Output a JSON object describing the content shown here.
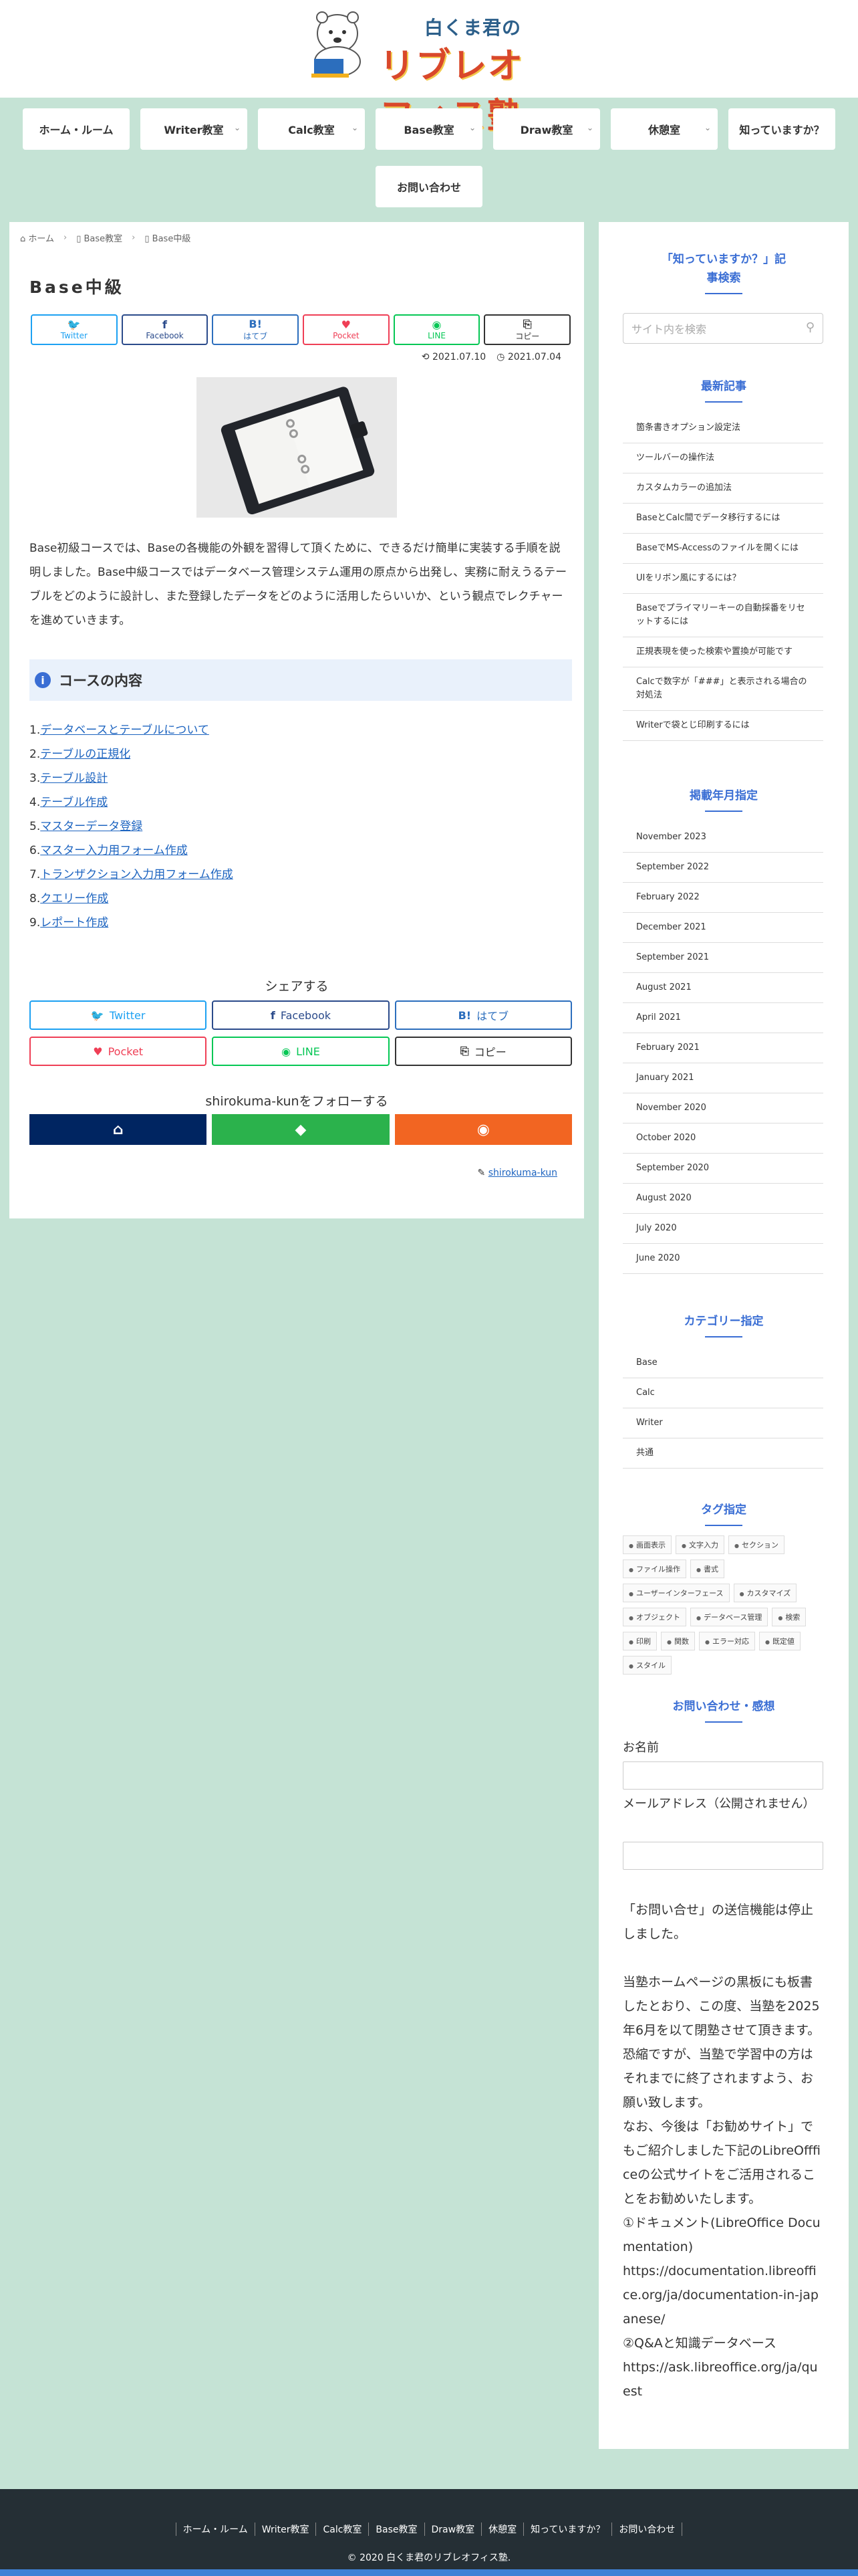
{
  "colors": {
    "background": "#c5e3d5",
    "accent": "#3a6ed4",
    "link": "#1d64c0",
    "footer": "#252f35",
    "twitter": "#1da1f2",
    "facebook": "#2b4b8b",
    "hatebu": "#2c6ebd",
    "pocket": "#ef3f56",
    "line": "#06c755",
    "copy": "#333333",
    "follow_home": "#002561",
    "follow_feedly": "#2bb24c",
    "follow_rss": "#f26522"
  },
  "header": {
    "logo_line1": "白くま君の",
    "logo_line2": "リブレオフィス塾",
    "logo_icon": "polar-bear-laptop-logo"
  },
  "nav": [
    {
      "label": "ホーム・ルーム",
      "dropdown": false
    },
    {
      "label": "Writer教室",
      "dropdown": true
    },
    {
      "label": "Calc教室",
      "dropdown": true
    },
    {
      "label": "Base教室",
      "dropdown": true
    },
    {
      "label": "Draw教室",
      "dropdown": true
    },
    {
      "label": "休憩室",
      "dropdown": true
    },
    {
      "label": "知っていますか？",
      "dropdown": false
    },
    {
      "label": "お問い合わせ",
      "dropdown": false
    }
  ],
  "breadcrumb": [
    "ホーム",
    "Base教室",
    "Base中級"
  ],
  "article": {
    "title": "Base中級",
    "updated": "2021.07.10",
    "published": "2021.07.04",
    "body": "Base初級コースでは、Baseの各機能の外観を習得して頂くために、できるだけ簡単に実装する手順を説明しました。Base中級コースではデータベース管理システム運用の原点から出発し、実務に耐えうるテーブルをどのように設計し、また登録したデータをどのように活用したらいいか、という観点でレクチャーを進めていきます。",
    "toc_title": "コースの内容",
    "toc": [
      {
        "num": "1.",
        "label": "データベースとテーブルについて"
      },
      {
        "num": "2.",
        "label": "テーブルの正規化"
      },
      {
        "num": "3.",
        "label": "テーブル設計"
      },
      {
        "num": "4.",
        "label": "テーブル作成"
      },
      {
        "num": "5.",
        "label": "マスターデータ登録"
      },
      {
        "num": "6.",
        "label": "マスター入力用フォーム作成"
      },
      {
        "num": "7.",
        "label": "トランザクション入力用フォーム作成"
      },
      {
        "num": "8.",
        "label": "クエリー作成"
      },
      {
        "num": "9.",
        "label": "レポート作成"
      }
    ],
    "author": "shirokuma-kun"
  },
  "share_top": [
    {
      "icon": "twitter-icon",
      "glyph": "🐦",
      "label": "Twitter",
      "color": "#1da1f2"
    },
    {
      "icon": "facebook-icon",
      "glyph": "f",
      "label": "Facebook",
      "color": "#2b4b8b"
    },
    {
      "icon": "hatebu-icon",
      "glyph": "B!",
      "label": "はてブ",
      "color": "#2c6ebd"
    },
    {
      "icon": "pocket-icon",
      "glyph": "♥",
      "label": "Pocket",
      "color": "#ef3f56"
    },
    {
      "icon": "line-icon",
      "glyph": "◉",
      "label": "LINE",
      "color": "#06c755"
    },
    {
      "icon": "copy-icon",
      "glyph": "⎘",
      "label": "コピー",
      "color": "#333333"
    }
  ],
  "share_bottom": {
    "heading": "シェアする",
    "buttons": [
      {
        "icon": "twitter-icon",
        "glyph": "🐦",
        "label": "Twitter",
        "color": "#1da1f2"
      },
      {
        "icon": "facebook-icon",
        "glyph": "f",
        "label": "Facebook",
        "color": "#2b4b8b"
      },
      {
        "icon": "hatebu-icon",
        "glyph": "B!",
        "label": "はてブ",
        "color": "#2c6ebd"
      },
      {
        "icon": "pocket-icon",
        "glyph": "♥",
        "label": "Pocket",
        "color": "#ef3f56"
      },
      {
        "icon": "line-icon",
        "glyph": "◉",
        "label": "LINE",
        "color": "#06c755"
      },
      {
        "icon": "copy-icon",
        "glyph": "⎘",
        "label": "コピー",
        "color": "#333333"
      }
    ]
  },
  "follow": {
    "heading": "shirokuma-kunをフォローする",
    "buttons": [
      {
        "icon": "home-icon",
        "glyph": "⌂",
        "color": "#002561"
      },
      {
        "icon": "feedly-icon",
        "glyph": "◆",
        "color": "#2bb24c"
      },
      {
        "icon": "rss-icon",
        "glyph": "◉",
        "color": "#f26522"
      }
    ]
  },
  "sidebar": {
    "search_title_l1": "「知っていますか？」記",
    "search_title_l2": "事検索",
    "search_placeholder": "サイト内を検索",
    "recent_title": "最新記事",
    "recent": [
      "箇条書きオプション設定法",
      "ツールバーの操作法",
      "カスタムカラーの追加法",
      "BaseとCalc間でデータ移行するには",
      "BaseでMS-Accessのファイルを開くには",
      "UIをリボン風にするには？",
      "Baseでプライマリーキーの自動採番をリセットするには",
      "正規表現を使った検索や置換が可能です",
      "Calcで数字が「###」と表示される場合の対処法",
      "Writerで袋とじ印刷するには"
    ],
    "archive_title": "掲載年月指定",
    "archives": [
      "November 2023",
      "September 2022",
      "February 2022",
      "December 2021",
      "September 2021",
      "August 2021",
      "April 2021",
      "February 2021",
      "January 2021",
      "November 2020",
      "October 2020",
      "September 2020",
      "August 2020",
      "July 2020",
      "June 2020"
    ],
    "category_title": "カテゴリー指定",
    "categories": [
      "Base",
      "Calc",
      "Writer",
      "共通"
    ],
    "tag_title": "タグ指定",
    "tags": [
      "画面表示",
      "文字入力",
      "セクション",
      "ファイル操作",
      "書式",
      "ユーザーインターフェース",
      "カスタマイズ",
      "オブジェクト",
      "データベース管理",
      "検索",
      "印刷",
      "関数",
      "エラー対応",
      "既定値",
      "スタイル"
    ],
    "contact_title": "お問い合わせ・感想",
    "name_label": "お名前",
    "email_label": "メールアドレス（公開されません）",
    "notice": "「お問い合せ」の送信機能は停止しました。\n\n当塾ホームページの黒板にも板書したとおり、この度、当塾を2025年6月を以て閉塾させて頂きます。恐縮ですが、当塾で学習中の方はそれまでに終了されますよう、お願い致します。\nなお、今後は「お勧めサイト」でもご紹介しました下記のLibreOffficeの公式サイトをご活用されることをお勧めいたします。\n①ドキュメント(LibreOffice Documentation)\nhttps://documentation.libreoffice.org/ja/documentation-in-japanese/\n②Q&Aと知識データベース\nhttps://ask.libreoffice.org/ja/quest"
  },
  "footer": {
    "links": [
      "ホーム・ルーム",
      "Writer教室",
      "Calc教室",
      "Base教室",
      "Draw教室",
      "休憩室",
      "知っていますか？",
      "お問い合わせ"
    ],
    "copyright": "© 2020 白くま君のリブレオフィス塾."
  }
}
